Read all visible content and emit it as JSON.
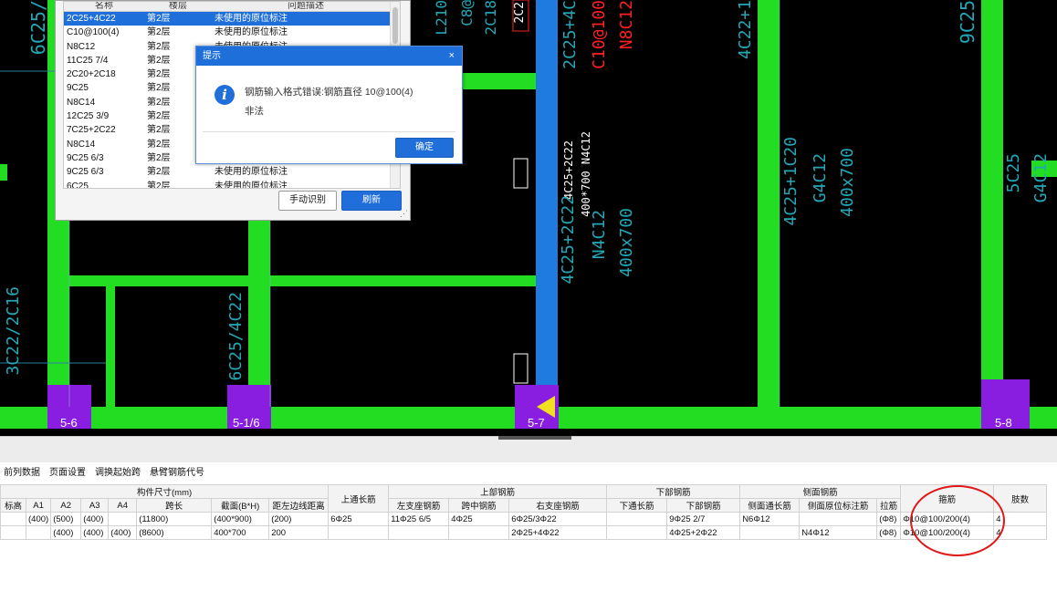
{
  "cad": {
    "annotations": [
      {
        "text": "6C25/",
        "color": "cyan"
      },
      {
        "text": "L210",
        "color": "cyan"
      },
      {
        "text": "C8@",
        "color": "cyan"
      },
      {
        "text": "2C18",
        "color": "cyan"
      },
      {
        "text": "2C2",
        "color": "white"
      },
      {
        "text": "2C25+4C",
        "color": "cyan"
      },
      {
        "text": "C10@100",
        "color": "red"
      },
      {
        "text": "N8C12",
        "color": "red"
      },
      {
        "text": "4C22+1",
        "color": "cyan"
      },
      {
        "text": "9C25",
        "color": "cyan"
      },
      {
        "text": "4C25+2C22",
        "color": "white"
      },
      {
        "text": "400*700 N4C12",
        "color": "white"
      },
      {
        "text": "4C25+2C22",
        "color": "cyan"
      },
      {
        "text": "N4C12",
        "color": "cyan"
      },
      {
        "text": "400x700",
        "color": "cyan"
      },
      {
        "text": "4C25+1C20",
        "color": "cyan"
      },
      {
        "text": "G4C12",
        "color": "cyan"
      },
      {
        "text": "400x700",
        "color": "cyan"
      },
      {
        "text": "5C25",
        "color": "cyan"
      },
      {
        "text": "G4C12",
        "color": "cyan"
      },
      {
        "text": "6C25/4C22",
        "color": "cyan"
      },
      {
        "text": "3C22/2C16",
        "color": "cyan"
      }
    ],
    "column_labels": [
      "5-6",
      "5-1/6",
      "5-7",
      "5-8"
    ]
  },
  "panel": {
    "headers": [
      "名称",
      "楼层",
      "问题描述"
    ],
    "rows": [
      {
        "name": "2C25+4C22",
        "floor": "第2层",
        "desc": "未使用的原位标注",
        "selected": true
      },
      {
        "name": "C10@100(4)",
        "floor": "第2层",
        "desc": "未使用的原位标注"
      },
      {
        "name": "N8C12",
        "floor": "第2层",
        "desc": "未使用的原位标注"
      },
      {
        "name": "11C25 7/4",
        "floor": "第2层",
        "desc": ""
      },
      {
        "name": "2C20+2C18",
        "floor": "第2层",
        "desc": ""
      },
      {
        "name": "9C25",
        "floor": "第2层",
        "desc": ""
      },
      {
        "name": "N8C14",
        "floor": "第2层",
        "desc": ""
      },
      {
        "name": "12C25 3/9",
        "floor": "第2层",
        "desc": ""
      },
      {
        "name": "7C25+2C22",
        "floor": "第2层",
        "desc": ""
      },
      {
        "name": "N8C14",
        "floor": "第2层",
        "desc": ""
      },
      {
        "name": "9C25 6/3",
        "floor": "第2层",
        "desc": ""
      },
      {
        "name": "9C25 6/3",
        "floor": "第2层",
        "desc": "未使用的原位标注"
      },
      {
        "name": "6C25",
        "floor": "第2层",
        "desc": "未使用的原位标注"
      }
    ],
    "btn_manual": "手动识别",
    "btn_refresh": "刷新"
  },
  "dialog": {
    "title": "提示",
    "close": "×",
    "message_line1": "钢筋输入格式错误:钢筋直径 10@100(4)",
    "message_line2": "非法",
    "ok": "确定"
  },
  "bottom": {
    "menu": [
      "前列数据",
      "页面设置",
      "调换起始跨",
      "悬臂钢筋代号"
    ],
    "group_headers": {
      "dims": "构件尺寸(mm)",
      "top_through": "上通长筋",
      "top": "上部钢筋",
      "bottom": "下部钢筋",
      "side": "侧面钢筋",
      "stirrup": "箍筋",
      "legs": "肢数"
    },
    "sub_headers": [
      "标高",
      "A1",
      "A2",
      "A3",
      "A4",
      "跨长",
      "截面(B*H)",
      "距左边线距离",
      "左支座钢筋",
      "跨中钢筋",
      "右支座钢筋",
      "下通长筋",
      "下部钢筋",
      "侧面通长筋",
      "侧面原位标注筋",
      "拉筋"
    ],
    "rows": [
      {
        "elev": "",
        "a1": "(400)",
        "a2": "(500)",
        "a3": "(400)",
        "a4": "",
        "span": "(11800)",
        "section": "(400*900)",
        "dist": "(200)",
        "top_through": "6Φ25",
        "left": "11Φ25 6/5",
        "mid": "4Φ25",
        "right": "6Φ25/3Φ22",
        "bot_through": "",
        "bot": "9Φ25 2/7",
        "side_through": "N6Φ12",
        "side_orig": "",
        "tie": "(Φ8)",
        "stirrup": "Φ10@100/200(4)",
        "legs": "4"
      },
      {
        "elev": "",
        "a1": "",
        "a2": "(400)",
        "a3": "(400)",
        "a4": "(400)",
        "span": "(8600)",
        "section": "400*700",
        "dist": "200",
        "top_through": "",
        "left": "",
        "mid": "",
        "right": "2Φ25+4Φ22",
        "bot_through": "",
        "bot": "4Φ25+2Φ22",
        "side_through": "",
        "side_orig": "N4Φ12",
        "tie": "(Φ8)",
        "stirrup": "Φ10@100/200(4)",
        "legs": "4"
      }
    ]
  }
}
